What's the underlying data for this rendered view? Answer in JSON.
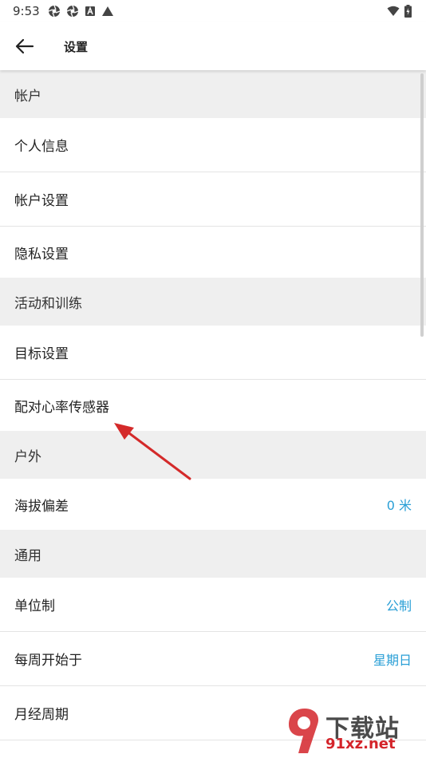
{
  "status_bar": {
    "time": "9:53",
    "icons": [
      "aperture-icon",
      "aperture-icon",
      "a-box-icon",
      "triangle-icon"
    ],
    "right_icons": [
      "wifi-icon",
      "battery-charging-icon"
    ]
  },
  "app_bar": {
    "title": "设置",
    "back_icon": "arrow-left-icon"
  },
  "sections": [
    {
      "header": "帐户",
      "items": [
        {
          "label": "个人信息",
          "value": ""
        },
        {
          "label": "帐户设置",
          "value": ""
        },
        {
          "label": "隐私设置",
          "value": ""
        }
      ]
    },
    {
      "header": "活动和训练",
      "items": [
        {
          "label": "目标设置",
          "value": ""
        },
        {
          "label": "配对心率传感器",
          "value": ""
        }
      ]
    },
    {
      "header": "户外",
      "items": [
        {
          "label": "海拔偏差",
          "value": "0 米"
        }
      ]
    },
    {
      "header": "通用",
      "items": [
        {
          "label": "单位制",
          "value": "公制"
        },
        {
          "label": "每周开始于",
          "value": "星期日"
        },
        {
          "label": "月经周期",
          "value": ""
        }
      ]
    }
  ],
  "watermark": {
    "text": "下载站",
    "domain": "91xz.net"
  },
  "colors": {
    "accent": "#2a9fd6",
    "section_bg": "#efefef",
    "arrow": "#d42a2a"
  }
}
